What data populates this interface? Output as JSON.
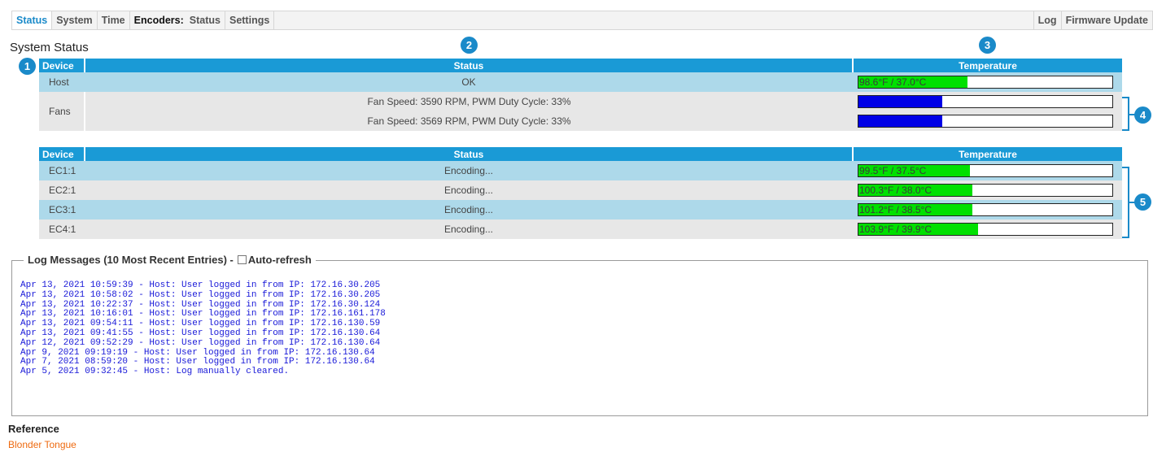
{
  "nav": {
    "left": [
      {
        "label": "Status",
        "active": true,
        "name": "tab-status"
      },
      {
        "label": "System",
        "name": "tab-system"
      },
      {
        "label": "Time",
        "name": "tab-time"
      },
      {
        "label": "Encoders:",
        "group": true,
        "name": "encoders-group-label"
      },
      {
        "label": "Status",
        "name": "tab-encoders-status"
      },
      {
        "label": "Settings",
        "name": "tab-encoders-settings"
      }
    ],
    "right": [
      {
        "label": "Log",
        "name": "tab-log"
      },
      {
        "label": "Firmware Update",
        "name": "tab-firmware-update"
      }
    ]
  },
  "page_title": "System Status",
  "callouts": [
    "1",
    "2",
    "3",
    "4",
    "5"
  ],
  "system_table": {
    "headers": {
      "device": "Device",
      "status": "Status",
      "temperature": "Temperature"
    },
    "host": {
      "device": "Host",
      "status": "OK",
      "temp_label": "98.6°F / 37.0°C",
      "temp_level": 0.43
    },
    "fans": {
      "device": "Fans",
      "rows": [
        {
          "status": "Fan Speed: 3590 RPM, PWM Duty Cycle: 33%",
          "duty": 0.33
        },
        {
          "status": "Fan Speed: 3569 RPM, PWM Duty Cycle: 33%",
          "duty": 0.33
        }
      ]
    }
  },
  "encoder_table": {
    "headers": {
      "device": "Device",
      "status": "Status",
      "temperature": "Temperature"
    },
    "rows": [
      {
        "device": "EC1:1",
        "status": "Encoding...",
        "temp_label": "99.5°F / 37.5°C",
        "temp_level": 0.44
      },
      {
        "device": "EC2:1",
        "status": "Encoding...",
        "temp_label": "100.3°F / 38.0°C",
        "temp_level": 0.45
      },
      {
        "device": "EC3:1",
        "status": "Encoding...",
        "temp_label": "101.2°F / 38.5°C",
        "temp_level": 0.45
      },
      {
        "device": "EC4:1",
        "status": "Encoding...",
        "temp_label": "103.9°F / 39.9°C",
        "temp_level": 0.47
      }
    ]
  },
  "log": {
    "legend": "Log Messages (10 Most Recent Entries) -",
    "autorefresh_label": "Auto-refresh",
    "autorefresh_checked": false,
    "lines": [
      "Apr 13, 2021 10:59:39 - Host: User logged in from IP: 172.16.30.205",
      "Apr 13, 2021 10:58:02 - Host: User logged in from IP: 172.16.30.205",
      "Apr 13, 2021 10:22:37 - Host: User logged in from IP: 172.16.30.124",
      "Apr 13, 2021 10:16:01 - Host: User logged in from IP: 172.16.161.178",
      "Apr 13, 2021 09:54:11 - Host: User logged in from IP: 172.16.130.59",
      "Apr 13, 2021 09:41:55 - Host: User logged in from IP: 172.16.130.64",
      "Apr 12, 2021 09:52:29 - Host: User logged in from IP: 172.16.130.64",
      "Apr 9, 2021 09:19:19 - Host: User logged in from IP: 172.16.130.64",
      "Apr 7, 2021 08:59:20 - Host: User logged in from IP: 172.16.130.64",
      "Apr 5, 2021 09:32:45 - Host: Log manually cleared."
    ]
  },
  "reference": {
    "title": "Reference",
    "link": "Blonder Tongue"
  },
  "colors": {
    "accent": "#1a8ac9",
    "header": "#1a9ad6",
    "temp_bar": "#00e000",
    "fan_bar": "#0000e6",
    "log_text": "#1818d8",
    "link": "#ee6a10"
  }
}
